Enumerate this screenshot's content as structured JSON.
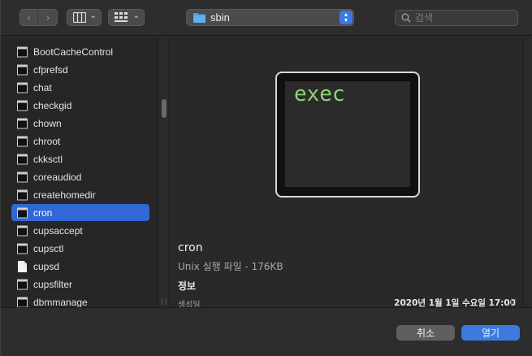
{
  "toolbar": {
    "back_icon": "chevron-left-icon",
    "forward_icon": "chevron-right-icon",
    "view_icon": "column-view-icon",
    "group_icon": "grid-view-icon",
    "location": {
      "label": "sbin",
      "icon": "folder-icon",
      "folder_color": "#4aa0e8"
    },
    "search": {
      "placeholder": "검색",
      "value": ""
    }
  },
  "file_list": {
    "items": [
      {
        "name": "BootCacheControl",
        "icon": "executable-icon"
      },
      {
        "name": "cfprefsd",
        "icon": "executable-icon"
      },
      {
        "name": "chat",
        "icon": "executable-icon"
      },
      {
        "name": "checkgid",
        "icon": "executable-icon"
      },
      {
        "name": "chown",
        "icon": "executable-icon"
      },
      {
        "name": "chroot",
        "icon": "executable-icon"
      },
      {
        "name": "ckksctl",
        "icon": "executable-icon"
      },
      {
        "name": "coreaudiod",
        "icon": "executable-icon"
      },
      {
        "name": "createhomedir",
        "icon": "executable-icon"
      },
      {
        "name": "cron",
        "icon": "executable-icon",
        "selected": true
      },
      {
        "name": "cupsaccept",
        "icon": "executable-icon"
      },
      {
        "name": "cupsctl",
        "icon": "executable-icon"
      },
      {
        "name": "cupsd",
        "icon": "document-icon"
      },
      {
        "name": "cupsfilter",
        "icon": "executable-icon"
      },
      {
        "name": "dbmmanage",
        "icon": "executable-icon"
      }
    ]
  },
  "preview": {
    "thumbnail_text": "exec",
    "name": "cron",
    "kind": "Unix 실행 파일 - 176KB",
    "info_heading": "정보",
    "created_label": "생성일",
    "created_value": "2020년 1월 1일 수요일 17:00"
  },
  "buttons": {
    "cancel": "취소",
    "open": "열기"
  },
  "colors": {
    "accent": "#3b7be0",
    "selection": "#3168d5",
    "thumbnail_text": "#8ed477"
  }
}
